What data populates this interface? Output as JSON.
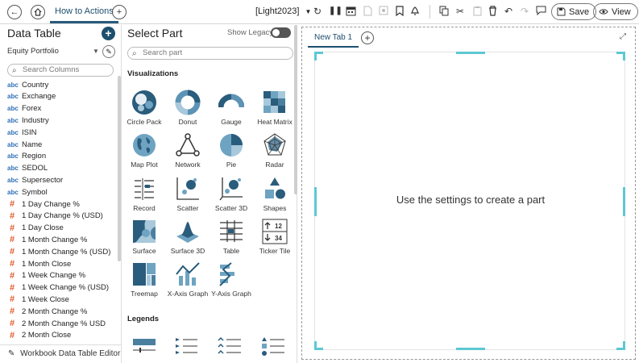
{
  "topbar": {
    "tab_label": "How to Actions",
    "theme_label": "[Light2023]",
    "save_label": "Save",
    "view_label": "View"
  },
  "data_table": {
    "title": "Data Table",
    "source": "Equity Portfolio",
    "search_placeholder": "Search Columns",
    "columns": [
      {
        "type": "abc",
        "name": "Country"
      },
      {
        "type": "abc",
        "name": "Exchange"
      },
      {
        "type": "abc",
        "name": "Forex"
      },
      {
        "type": "abc",
        "name": "Industry"
      },
      {
        "type": "abc",
        "name": "ISIN"
      },
      {
        "type": "abc",
        "name": "Name"
      },
      {
        "type": "abc",
        "name": "Region"
      },
      {
        "type": "abc",
        "name": "SEDOL"
      },
      {
        "type": "abc",
        "name": "Supersector"
      },
      {
        "type": "abc",
        "name": "Symbol"
      },
      {
        "type": "#",
        "name": "1 Day Change %"
      },
      {
        "type": "#",
        "name": "1 Day Change % (USD)"
      },
      {
        "type": "#",
        "name": "1 Day Close"
      },
      {
        "type": "#",
        "name": "1 Month Change %"
      },
      {
        "type": "#",
        "name": "1 Month Change % (USD)"
      },
      {
        "type": "#",
        "name": "1 Month Close"
      },
      {
        "type": "#",
        "name": "1 Week Change %"
      },
      {
        "type": "#",
        "name": "1 Week Change % (USD)"
      },
      {
        "type": "#",
        "name": "1 Week Close"
      },
      {
        "type": "#",
        "name": "2 Month Change %"
      },
      {
        "type": "#",
        "name": "2 Month Change % USD"
      },
      {
        "type": "#",
        "name": "2 Month Close"
      }
    ],
    "footer": "Workbook Data Table Editor"
  },
  "select_part": {
    "title": "Select Part",
    "legacy_label": "Show Legacy",
    "search_placeholder": "Search part",
    "visualizations_label": "Visualizations",
    "legends_label": "Legends",
    "parts": [
      "Circle Pack",
      "Donut",
      "Gauge",
      "Heat Matrix",
      "Map Plot",
      "Network",
      "Pie",
      "Radar",
      "Record",
      "Scatter",
      "Scatter 3D",
      "Shapes",
      "Surface",
      "Surface 3D",
      "Table",
      "Ticker Tile",
      "Treemap",
      "X-Axis Graph",
      "Y-Axis Graph"
    ],
    "ticker_values": [
      "12",
      "34"
    ]
  },
  "canvas": {
    "tab_label": "New Tab 1",
    "message": "Use the settings to create a part"
  },
  "colors": {
    "accent": "#1d4f6e",
    "handle": "#5cc8d2",
    "number_type": "#e05a2b",
    "text_type": "#2e6fb7"
  }
}
